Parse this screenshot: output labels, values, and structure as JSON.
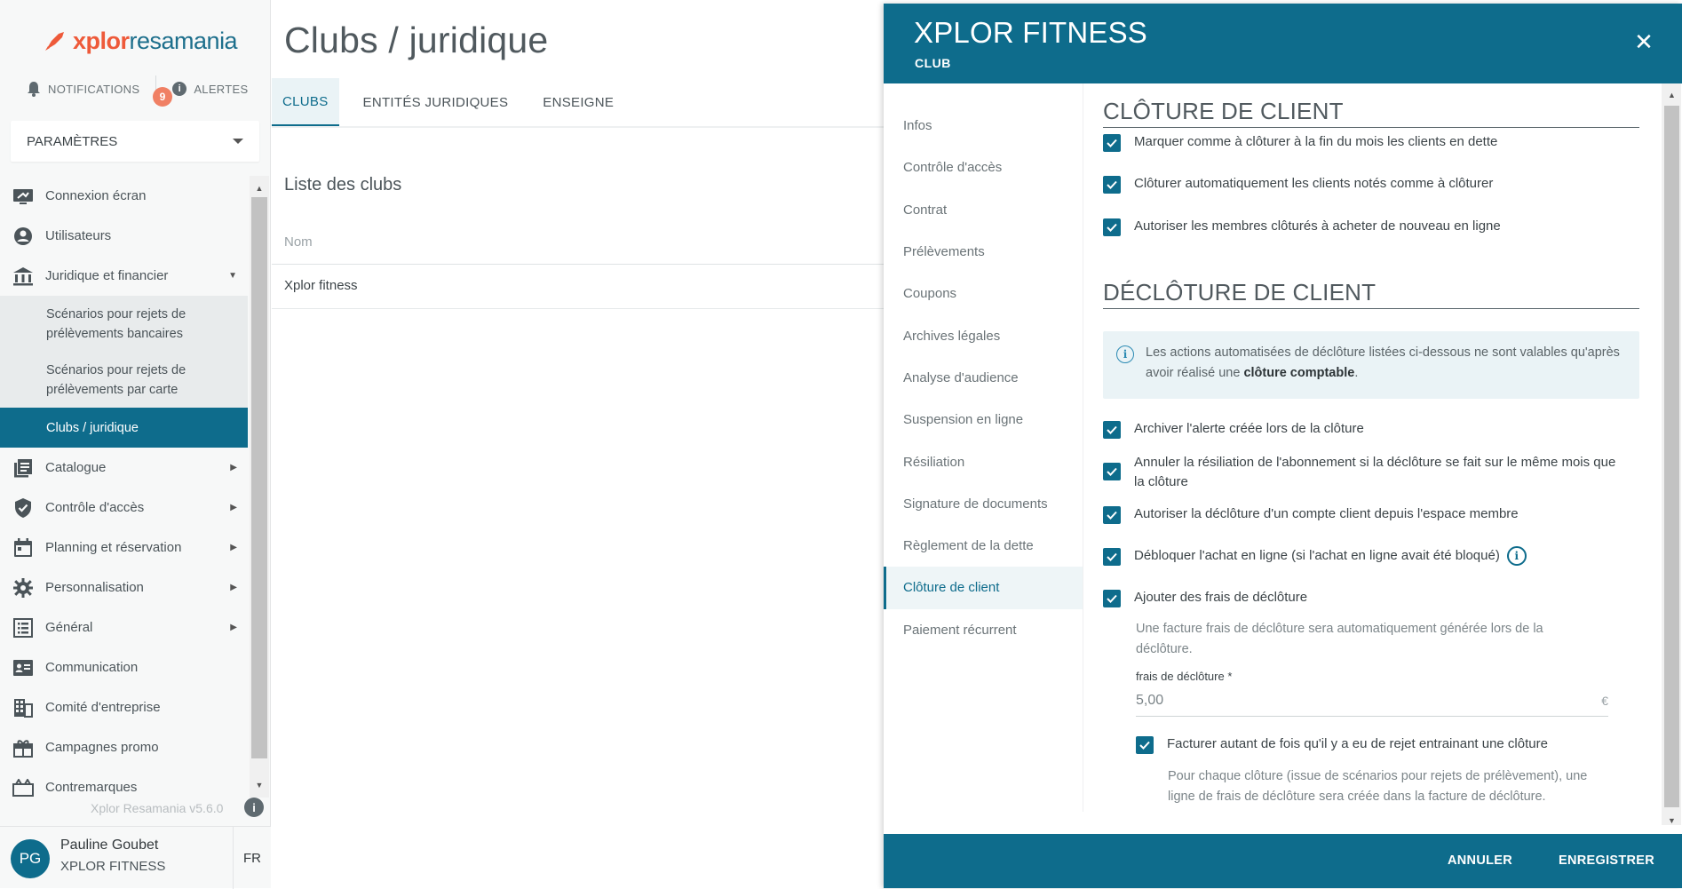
{
  "brand": {
    "logo_text_bold": "xplor",
    "logo_text": "resamania",
    "accent": "#ee5a3a",
    "primary": "#0e6c8c"
  },
  "topbar": {
    "notifications_label": "NOTIFICATIONS",
    "alerts_label": "ALERTES",
    "alerts_count": "9"
  },
  "sidebar": {
    "settings_label": "PARAMÈTRES",
    "items": [
      {
        "label": "Connexion écran",
        "icon": "screen-login-icon"
      },
      {
        "label": "Utilisateurs",
        "icon": "user-icon"
      },
      {
        "label": "Juridique et financier",
        "icon": "bank-icon"
      },
      {
        "label": "Scénarios pour rejets de prélèvements bancaires"
      },
      {
        "label": "Scénarios pour rejets de prélèvements par carte"
      },
      {
        "label": "Clubs / juridique"
      },
      {
        "label": "Catalogue",
        "icon": "catalog-icon"
      },
      {
        "label": "Contrôle d'accès",
        "icon": "shield-icon"
      },
      {
        "label": "Planning et réservation",
        "icon": "calendar-icon"
      },
      {
        "label": "Personnalisation",
        "icon": "gear-icon"
      },
      {
        "label": "Général",
        "icon": "list-icon"
      },
      {
        "label": "Communication",
        "icon": "contact-card-icon"
      },
      {
        "label": "Comité d'entreprise",
        "icon": "building-icon"
      },
      {
        "label": "Campagnes promo",
        "icon": "gift-icon"
      },
      {
        "label": "Contremarques",
        "icon": "ticket-icon"
      }
    ],
    "version": "Xplor Resamania v5.6.0"
  },
  "user": {
    "initials": "PG",
    "name": "Pauline Goubet",
    "club": "XPLOR FITNESS",
    "lang": "FR"
  },
  "main": {
    "title": "Clubs / juridique",
    "tabs": [
      "CLUBS",
      "ENTITÉS JURIDIQUES",
      "ENSEIGNE"
    ],
    "list_title": "Liste des clubs",
    "column_name": "Nom",
    "rows": [
      "Xplor fitness"
    ]
  },
  "panel": {
    "title": "XPLOR FITNESS",
    "subtitle": "CLUB",
    "nav": [
      "Infos",
      "Contrôle d'accès",
      "Contrat",
      "Prélèvements",
      "Coupons",
      "Archives légales",
      "Analyse d'audience",
      "Suspension en ligne",
      "Résiliation",
      "Signature de documents",
      "Règlement de la dette",
      "Clôture de client",
      "Paiement récurrent"
    ],
    "section1_title": "CLÔTURE DE CLIENT",
    "section1_checks": [
      "Marquer comme à clôturer à la fin du mois les clients en dette",
      "Clôturer automatiquement les clients notés comme à clôturer",
      "Autoriser les membres clôturés à acheter de nouveau en ligne"
    ],
    "section2_title": "DÉCLÔTURE DE CLIENT",
    "info_text": "Les actions automatisées de déclôture listées ci-dessous ne sont valables qu'après avoir réalisé une",
    "info_bold": "clôture comptable",
    "info_end": ".",
    "section2_checks": [
      "Archiver l'alerte créée lors de la clôture",
      "Annuler la résiliation de l'abonnement si la déclôture se fait sur le même mois que la clôture",
      "Autoriser la déclôture d'un compte client depuis l'espace membre",
      "Débloquer l'achat en ligne (si l'achat en ligne avait été bloqué)",
      "Ajouter des frais de déclôture"
    ],
    "fee_help": "Une facture frais de déclôture sera automatiquement générée lors de la déclôture.",
    "fee_label": "frais de déclôture *",
    "fee_value": "5,00",
    "fee_unit": "€",
    "multi_check": "Facturer autant de fois qu'il y a eu de rejet entrainant une clôture",
    "multi_help": "Pour chaque clôture (issue de scénarios pour rejets de prélèvement), une ligne de frais de déclôture sera créée dans la facture de déclôture.",
    "cancel_label": "ANNULER",
    "save_label": "ENREGISTRER"
  }
}
